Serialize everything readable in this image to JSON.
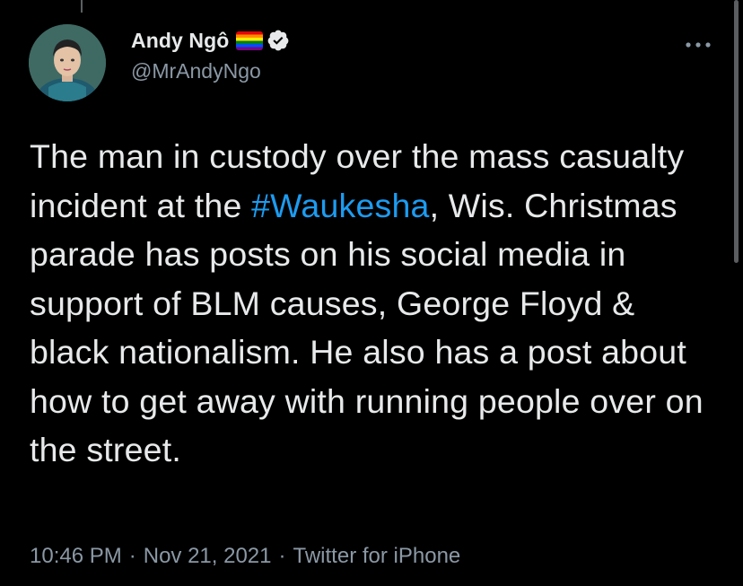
{
  "tweet": {
    "author": {
      "display_name": "Andy Ngô",
      "handle": "@MrAndyNgo",
      "badges": [
        "rainbow-flag-icon",
        "verified-icon"
      ]
    },
    "text": {
      "before_hashtag": "The man in custody over the mass casualty incident at the ",
      "hashtag": "#Waukesha",
      "after_hashtag": ", Wis. Christmas parade has posts on his social media in support of BLM causes, George Floyd & black nationalism. He also has a post about how to get away with running people over on the street."
    },
    "time": "10:46 PM",
    "separator": "·",
    "date": "Nov 21, 2021",
    "source": "Twitter for iPhone"
  },
  "icons": {
    "more": "more-horizontal-icon",
    "verified": "verified-icon",
    "flag": "rainbow-flag-icon"
  },
  "colors": {
    "background": "#000000",
    "text": "#e7e9ea",
    "secondary": "#8b98a5",
    "link": "#1d9bf0"
  }
}
